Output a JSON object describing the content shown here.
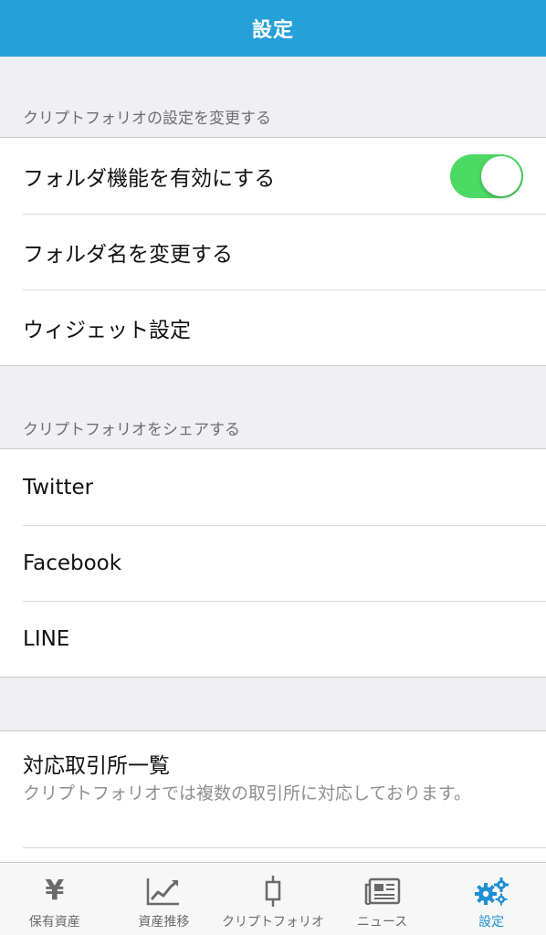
{
  "nav": {
    "title": "設定"
  },
  "sections": {
    "settings_header": "クリプトフォリオの設定を変更する",
    "share_header": "クリプトフォリオをシェアする"
  },
  "settings_rows": {
    "folder_feature": "フォルダ機能を有効にする",
    "folder_feature_enabled": true,
    "rename_folder": "フォルダ名を変更する",
    "widget_settings": "ウィジェット設定"
  },
  "share_rows": {
    "twitter": "Twitter",
    "facebook": "Facebook",
    "line": "LINE"
  },
  "exchange": {
    "title": "対応取引所一覧",
    "description": "クリプトフォリオでは複数の取引所に対応しております。"
  },
  "tabs": [
    {
      "label": "保有資産",
      "icon": "yen-icon"
    },
    {
      "label": "資産推移",
      "icon": "chart-trend-icon"
    },
    {
      "label": "クリプトフォリオ",
      "icon": "candlestick-icon"
    },
    {
      "label": "ニュース",
      "icon": "newspaper-icon"
    },
    {
      "label": "設定",
      "icon": "gears-icon",
      "active": true
    }
  ],
  "colors": {
    "accent": "#25a0d8",
    "toggle_on": "#4cd964",
    "active_tab": "#1f8fd4",
    "inactive_tab": "#6a6a6a"
  }
}
